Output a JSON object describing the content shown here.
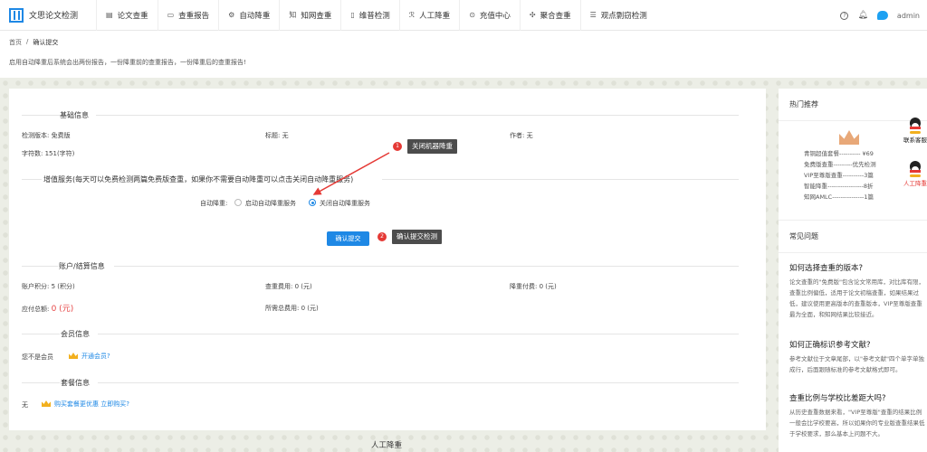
{
  "header": {
    "logo_text": "文思论文检测",
    "nav": [
      {
        "icon": "clipboard-icon",
        "glyph": "▤",
        "label": "论文查重"
      },
      {
        "icon": "report-icon",
        "glyph": "▭",
        "label": "查重报告"
      },
      {
        "icon": "gear-icon",
        "glyph": "⚙",
        "label": "自动降重"
      },
      {
        "icon": "zhiwang-icon",
        "glyph": "知",
        "label": "知网查重"
      },
      {
        "icon": "document-icon",
        "glyph": "▯",
        "label": "维普检测"
      },
      {
        "icon": "person-icon",
        "glyph": "ℛ",
        "label": "人工降重"
      },
      {
        "icon": "play-icon",
        "glyph": "⊙",
        "label": "充值中心"
      },
      {
        "icon": "network-icon",
        "glyph": "✣",
        "label": "聚合查重"
      },
      {
        "icon": "list-icon",
        "glyph": "☰",
        "label": "观点剽窃检测"
      }
    ],
    "help_glyph": "?",
    "user": "admin"
  },
  "breadcrumb": {
    "home": "首页",
    "sep": "/",
    "current": "确认提交"
  },
  "notice": "启用自动降重后系统会出两份报告，一份降重前的查重报告，一份降重后的查重报告!",
  "basic": {
    "title": "基础信息",
    "version": "检测版本: 免费版",
    "doc_title": "标题: 无",
    "author": "作者: 无",
    "word_count": "字符数: 151(字符)"
  },
  "value_added": {
    "title": "增值服务(每天可以免费检测两篇免费版查重，如果你不需要自动降重可以点击关闭自动降重服务)",
    "auto_label": "自动降重:",
    "option_on": "启动自动降重服务",
    "option_off": "关闭自动降重服务",
    "selected": "关闭自动降重服务"
  },
  "submit": {
    "label": "确认提交"
  },
  "annotations": [
    {
      "num": "1",
      "text": "关闭机器降重"
    },
    {
      "num": "2",
      "text": "确认提交检测"
    }
  ],
  "account": {
    "title": "账户/结算信息",
    "points": "账户积分: 5 (积分)",
    "fee": "查重费用: 0 (元)",
    "reduce_fee": "降重付费: 0 (元)",
    "total_label": "应付总额:",
    "total_value": "0 (元)",
    "needed": "所需总费用: 0 (元)"
  },
  "member": {
    "title": "会员信息",
    "status": "您不是会员",
    "open_link": "开通会员?"
  },
  "package": {
    "title": "套餐信息",
    "value": "无",
    "buy_link": "购买套餐更优惠 立即购买?"
  },
  "sidebar": {
    "hot_title": "热门推荐",
    "recommend": [
      "青铜超值套餐---------- ¥69",
      "免费版查重---------优先检测",
      "VIP至尊版查重----------3篇",
      "智能降重-----------------8折",
      "知网AMLC---------------1篇"
    ],
    "faq_title": "常见问题",
    "faqs": [
      {
        "q": "如何选择查重的版本?",
        "a": "论文查重的\"免费版\"包含论文常用库，对比库有限，查重比例偏低，适用于论文初稿查重，如果结果过低，建议使用更高版本的查重版本，VIP至尊版查重最为全面，和知网结果比较接近。"
      },
      {
        "q": "如何正确标识参考文献?",
        "a": "参考文献位于文章尾部，以\"参考文献\"四个单字单独成行，后面跟随标准的参考文献格式即可。"
      },
      {
        "q": "查重比例与学校比差距大吗?",
        "a": "从历史查重数据来看，\"VIP至尊版\"查重的结果比例一般会比学校要高，所以如果你的专业版查重结果低于学校要求，那么基本上问题不大。"
      }
    ]
  },
  "float": {
    "contact": "联系客服",
    "manual": "人工降重"
  },
  "bottom_title": "人工降重",
  "colors": {
    "accent": "#1e88e5",
    "danger": "#e53935",
    "tooltip": "#4c4c4c"
  }
}
